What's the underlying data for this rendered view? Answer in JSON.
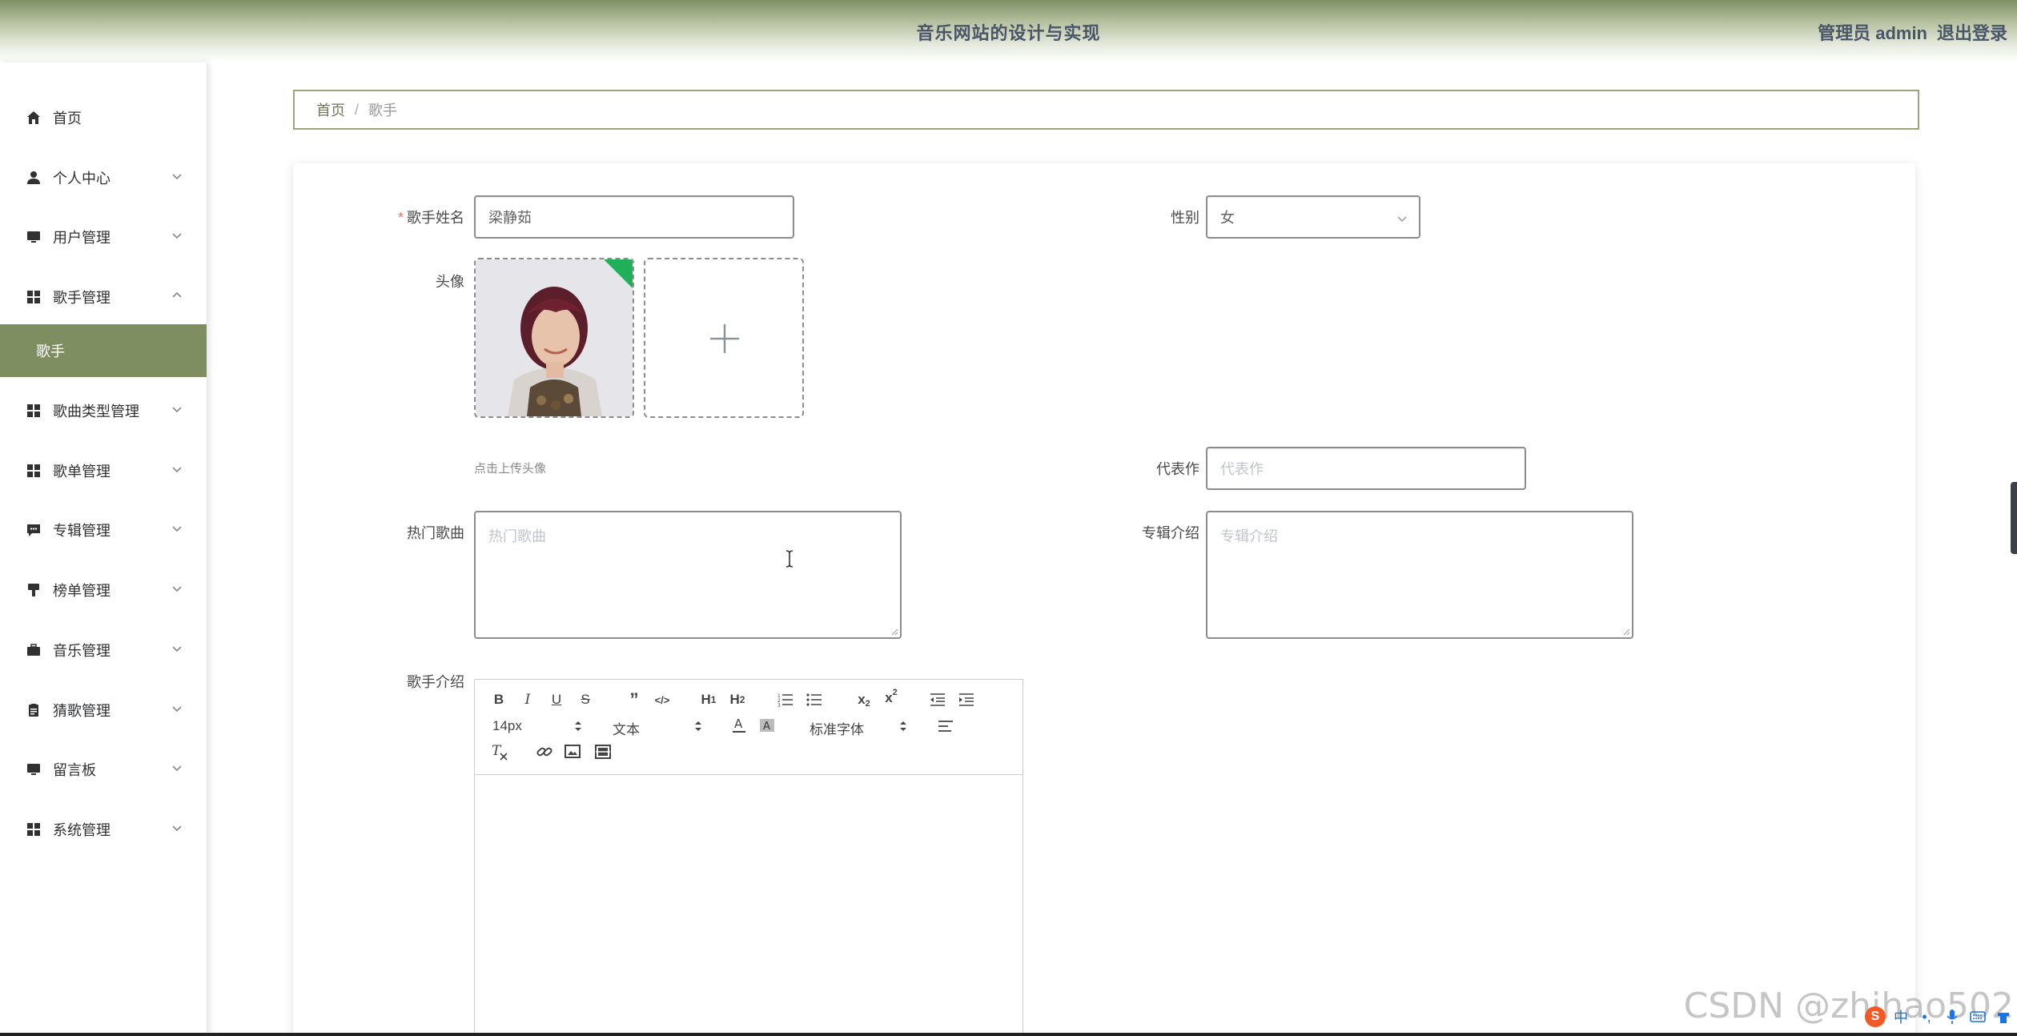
{
  "header": {
    "title": "音乐网站的设计与实现",
    "admin": "管理员 admin",
    "logout": "退出登录"
  },
  "sidebar": {
    "items": [
      {
        "label": "首页",
        "icon": "home-icon"
      },
      {
        "label": "个人中心",
        "icon": "user-icon"
      },
      {
        "label": "用户管理",
        "icon": "monitor-icon"
      },
      {
        "label": "歌手管理",
        "icon": "grid-icon",
        "expanded": true
      },
      {
        "label": "歌曲类型管理",
        "icon": "grid-icon"
      },
      {
        "label": "歌单管理",
        "icon": "grid-icon"
      },
      {
        "label": "专辑管理",
        "icon": "chat-icon"
      },
      {
        "label": "榜单管理",
        "icon": "brush-icon"
      },
      {
        "label": "音乐管理",
        "icon": "briefcase-icon"
      },
      {
        "label": "猜歌管理",
        "icon": "clipboard-icon"
      },
      {
        "label": "留言板",
        "icon": "monitor-icon"
      },
      {
        "label": "系统管理",
        "icon": "grid-icon"
      }
    ],
    "active_sub": "歌手"
  },
  "breadcrumb": {
    "home": "首页",
    "separator": "/",
    "current": "歌手"
  },
  "form": {
    "singer_name_label": "歌手姓名",
    "singer_name_value": "梁静茹",
    "gender_label": "性别",
    "gender_value": "女",
    "avatar_label": "头像",
    "avatar_hint": "点击上传头像",
    "masterpiece_label": "代表作",
    "masterpiece_placeholder": "代表作",
    "hot_songs_label": "热门歌曲",
    "hot_songs_placeholder": "热门歌曲",
    "album_intro_label": "专辑介绍",
    "album_intro_placeholder": "专辑介绍",
    "singer_intro_label": "歌手介绍"
  },
  "editor": {
    "font_size": "14px",
    "text_type": "文本",
    "font_family": "标准字体"
  },
  "watermark": "CSDN @zhihao502",
  "colors": {
    "accent": "#7f8e60",
    "required": "#f56c6c"
  }
}
